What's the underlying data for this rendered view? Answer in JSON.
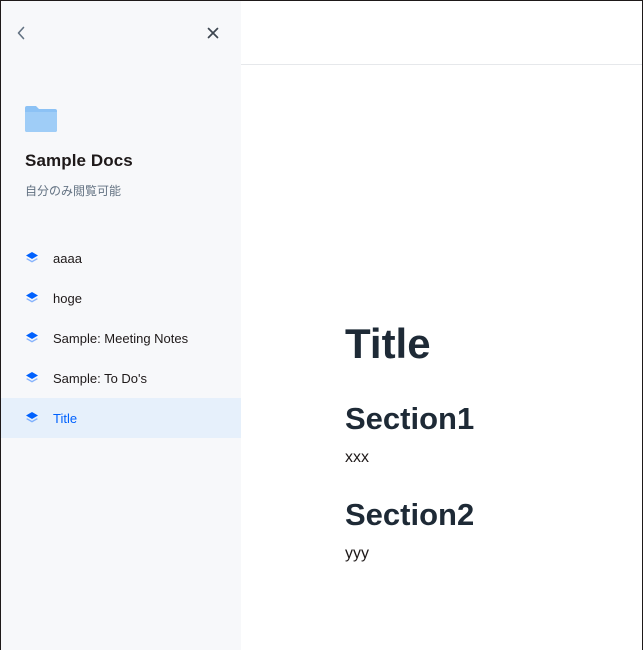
{
  "sidebar": {
    "back_icon": "chevron-left-icon",
    "close_icon": "close-icon",
    "folder_icon": "folder-icon",
    "folder_color": "#8cc2f5",
    "folder_name": "Sample Docs",
    "visibility": "自分のみ閲覧可能",
    "doc_icon": "stack-icon",
    "doc_icon_color": "#0061fe",
    "docs": [
      {
        "label": "aaaa",
        "active": false
      },
      {
        "label": "hoge",
        "active": false
      },
      {
        "label": "Sample: Meeting Notes",
        "active": false
      },
      {
        "label": "Sample: To Do's",
        "active": false
      },
      {
        "label": "Title",
        "active": true
      }
    ]
  },
  "document": {
    "title": "Title",
    "sections": [
      {
        "heading": "Section1",
        "body": "xxx"
      },
      {
        "heading": "Section2",
        "body": "yyy"
      }
    ]
  },
  "colors": {
    "sidebar_bg": "#f7f8fa",
    "active_bg": "#e6f0fb",
    "active_text": "#0061fe",
    "heading_text": "#1e2a36"
  }
}
